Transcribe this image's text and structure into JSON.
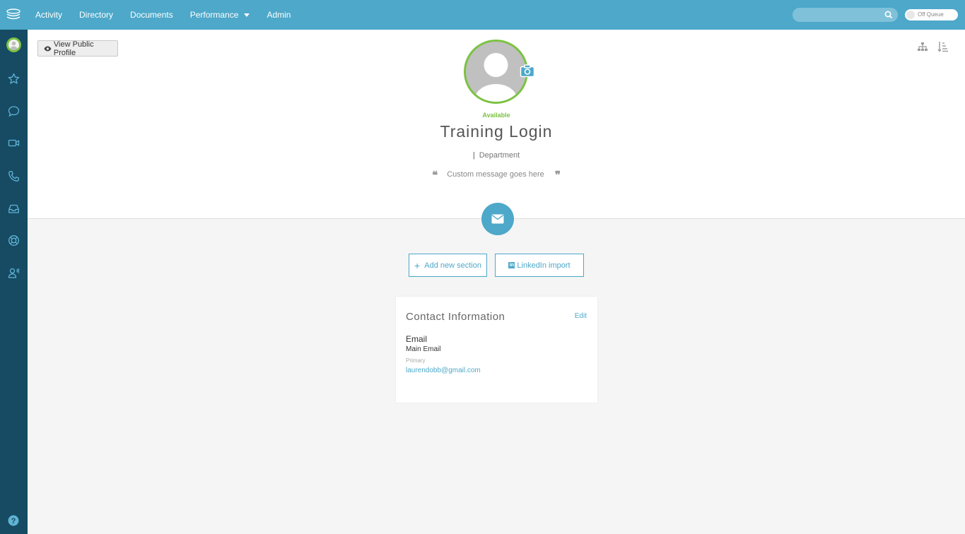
{
  "topbar": {
    "nav": [
      {
        "label": "Activity"
      },
      {
        "label": "Directory"
      },
      {
        "label": "Documents"
      },
      {
        "label": "Performance",
        "has_dropdown": true
      },
      {
        "label": "Admin"
      }
    ],
    "search": {
      "placeholder": ""
    },
    "queue_toggle": {
      "label": "Off Queue",
      "on": false
    }
  },
  "sidebar": {
    "icons": [
      "avatar",
      "star-icon",
      "chat-icon",
      "video-icon",
      "phone-icon",
      "inbox-icon",
      "lifebuoy-icon",
      "contacts-icon"
    ],
    "help_icon": "help-icon"
  },
  "profile": {
    "view_public_label": "View Public Profile",
    "status": "Available",
    "name": "Training Login",
    "pipe": "|",
    "department": "Department",
    "custom_message": "Custom message goes here",
    "actions": {
      "add_section": "Add new section",
      "linkedin_import": "LinkedIn import"
    }
  },
  "contact_card": {
    "title": "Contact Information",
    "edit_label": "Edit",
    "email_label": "Email",
    "email_type": "Main Email",
    "email_tag": "Primary",
    "email_value": "laurendobb@gmail.com"
  },
  "colors": {
    "topbar": "#4da8c9",
    "sidebar": "#164b63",
    "available": "#7cc242",
    "accent": "#4da8c9"
  }
}
